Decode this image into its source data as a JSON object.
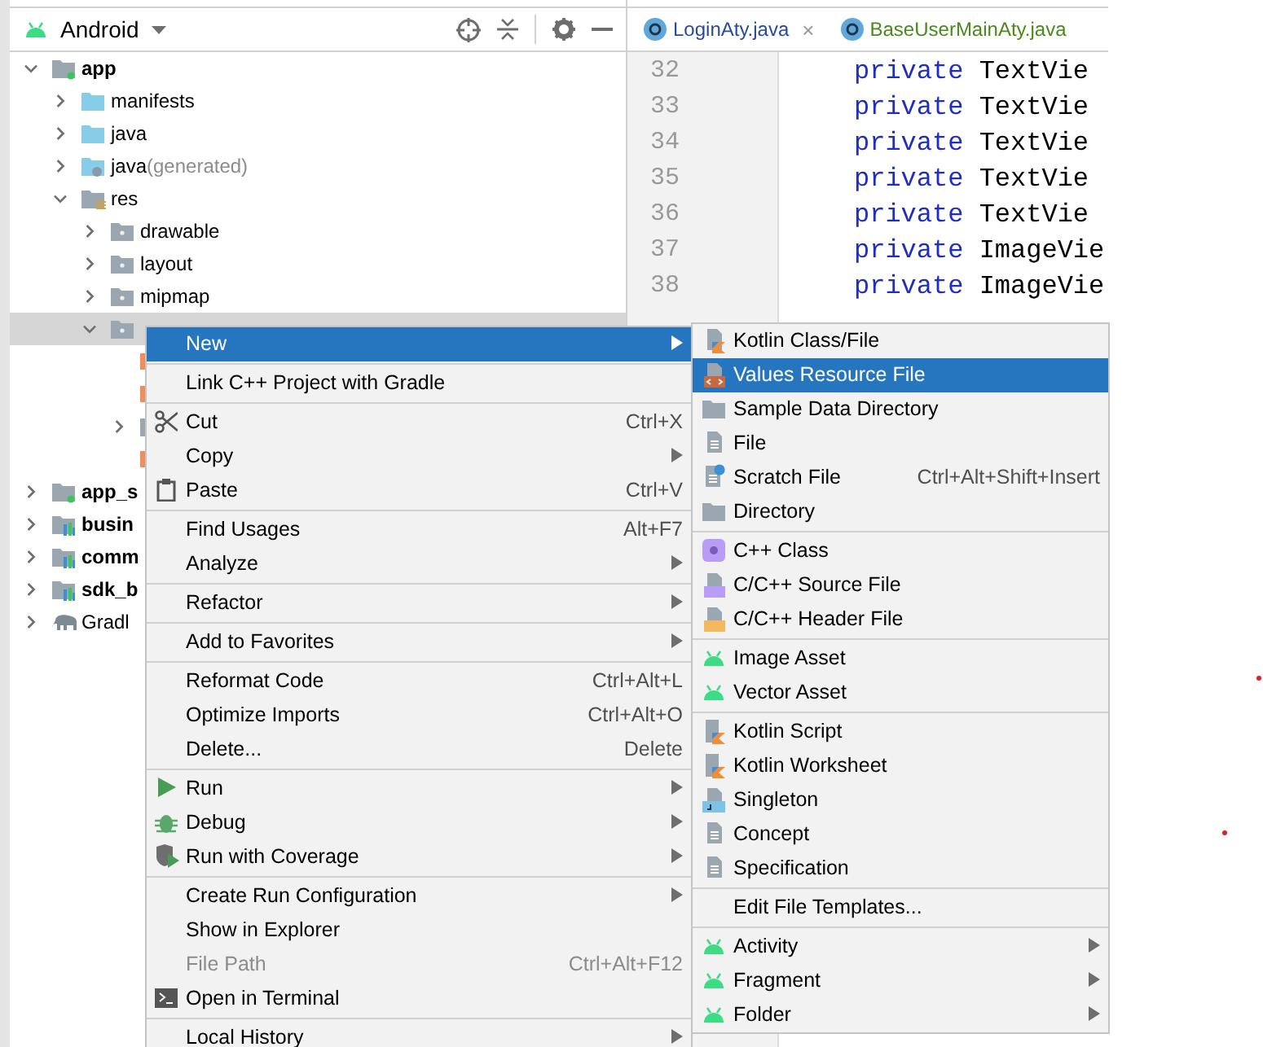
{
  "project_view": {
    "title": "Android",
    "tree": [
      {
        "label": "app",
        "kind": "module",
        "expanded": true,
        "selected": false,
        "children": [
          {
            "label": "manifests",
            "kind": "folder",
            "expanded": false,
            "selected": false
          },
          {
            "label": "java",
            "kind": "folder",
            "expanded": false,
            "selected": false
          },
          {
            "label": "java",
            "suffix": "(generated)",
            "kind": "generated-folder",
            "expanded": false,
            "selected": false
          },
          {
            "label": "res",
            "kind": "res-folder",
            "expanded": true,
            "selected": false,
            "children": [
              {
                "label": "drawable",
                "kind": "package-folder",
                "expanded": false,
                "selected": false
              },
              {
                "label": "layout",
                "kind": "package-folder",
                "expanded": false,
                "selected": false
              },
              {
                "label": "mipmap",
                "kind": "package-folder",
                "expanded": false,
                "selected": false
              },
              {
                "kind": "package-folder",
                "expanded": true,
                "selected": true,
                "children": [
                  {
                    "kind": "xml-file",
                    "selected": false
                  },
                  {
                    "kind": "xml-file",
                    "selected": false
                  },
                  {
                    "kind": "package-folder",
                    "expanded": false,
                    "selected": false
                  },
                  {
                    "kind": "xml-file",
                    "selected": false
                  }
                ]
              }
            ]
          }
        ]
      },
      {
        "label": "app_s",
        "kind": "module",
        "expanded": false,
        "selected": false
      },
      {
        "label": "busin",
        "kind": "library-module",
        "expanded": false,
        "selected": false
      },
      {
        "label": "comm",
        "kind": "library-module",
        "expanded": false,
        "selected": false
      },
      {
        "label": "sdk_b",
        "kind": "library-module",
        "expanded": false,
        "selected": false
      },
      {
        "label": "Gradl",
        "kind": "gradle",
        "expanded": false,
        "selected": false
      }
    ]
  },
  "editor": {
    "tabs": [
      {
        "label": "LoginAty.java",
        "color": "#2a4a9a",
        "close": "×",
        "selected": false
      },
      {
        "label": "BaseUserMainAty.java",
        "color": "#4a8a1a",
        "selected": false
      }
    ],
    "lines": [
      {
        "number": "32",
        "keyword": "private",
        "text": "TextVie"
      },
      {
        "number": "33",
        "keyword": "private",
        "text": "TextVie"
      },
      {
        "number": "34",
        "keyword": "private",
        "text": "TextVie"
      },
      {
        "number": "35",
        "keyword": "private",
        "text": "TextVie"
      },
      {
        "number": "36",
        "keyword": "private",
        "text": "TextVie"
      },
      {
        "number": "37",
        "keyword": "private",
        "text": "ImageVie"
      },
      {
        "number": "38",
        "keyword": "private",
        "text": "ImageVie"
      }
    ]
  },
  "context_menu": {
    "groups": [
      [
        {
          "label": "New",
          "submenu": true,
          "selected": true,
          "disabled": false
        }
      ],
      [
        {
          "label": "Link C++ Project with Gradle",
          "submenu": false,
          "selected": false,
          "disabled": false
        }
      ],
      [
        {
          "label": "Cut",
          "kind": "scissors",
          "shortcut": "Ctrl+X",
          "submenu": false,
          "selected": false,
          "disabled": false
        },
        {
          "label": "Copy",
          "submenu": true,
          "selected": false,
          "disabled": false
        },
        {
          "label": "Paste",
          "kind": "clipboard",
          "shortcut": "Ctrl+V",
          "submenu": false,
          "selected": false,
          "disabled": false
        }
      ],
      [
        {
          "label": "Find Usages",
          "shortcut": "Alt+F7",
          "submenu": false,
          "selected": false,
          "disabled": false
        },
        {
          "label": "Analyze",
          "submenu": true,
          "selected": false,
          "disabled": false
        }
      ],
      [
        {
          "label": "Refactor",
          "submenu": true,
          "selected": false,
          "disabled": false
        }
      ],
      [
        {
          "label": "Add to Favorites",
          "submenu": true,
          "selected": false,
          "disabled": false
        }
      ],
      [
        {
          "label": "Reformat Code",
          "shortcut": "Ctrl+Alt+L",
          "submenu": false,
          "selected": false,
          "disabled": false
        },
        {
          "label": "Optimize Imports",
          "shortcut": "Ctrl+Alt+O",
          "submenu": false,
          "selected": false,
          "disabled": false
        },
        {
          "label": "Delete...",
          "shortcut": "Delete",
          "submenu": false,
          "selected": false,
          "disabled": false
        }
      ],
      [
        {
          "label": "Run",
          "kind": "play",
          "submenu": true,
          "selected": false,
          "disabled": false
        },
        {
          "label": "Debug",
          "kind": "bug",
          "submenu": true,
          "selected": false,
          "disabled": false
        },
        {
          "label": "Run with Coverage",
          "kind": "coverage",
          "submenu": true,
          "selected": false,
          "disabled": false
        }
      ],
      [
        {
          "label": "Create Run Configuration",
          "submenu": true,
          "selected": false,
          "disabled": false
        },
        {
          "label": "Show in Explorer",
          "submenu": false,
          "selected": false,
          "disabled": false
        },
        {
          "label": "File Path",
          "shortcut": "Ctrl+Alt+F12",
          "submenu": false,
          "selected": false,
          "disabled": true
        },
        {
          "label": "Open in Terminal",
          "kind": "terminal",
          "submenu": false,
          "selected": false,
          "disabled": false
        }
      ],
      [
        {
          "label": "Local History",
          "submenu": true,
          "selected": false,
          "disabled": false
        }
      ]
    ]
  },
  "submenu": {
    "groups": [
      [
        {
          "label": "Kotlin Class/File",
          "kind": "kotlin-file",
          "submenu": false,
          "selected": false,
          "disabled": false
        },
        {
          "label": "Values Resource File",
          "kind": "values-file",
          "submenu": false,
          "selected": true,
          "disabled": false
        },
        {
          "label": "Sample Data Directory",
          "kind": "folder",
          "submenu": false,
          "selected": false,
          "disabled": false
        },
        {
          "label": "File",
          "kind": "document",
          "submenu": false,
          "selected": false,
          "disabled": false
        },
        {
          "label": "Scratch File",
          "kind": "scratch",
          "shortcut": "Ctrl+Alt+Shift+Insert",
          "submenu": false,
          "selected": false,
          "disabled": false
        },
        {
          "label": "Directory",
          "kind": "folder",
          "submenu": false,
          "selected": false,
          "disabled": false
        }
      ],
      [
        {
          "label": "C++ Class",
          "kind": "cpp-class",
          "submenu": false,
          "selected": false,
          "disabled": false
        },
        {
          "label": "C/C++ Source File",
          "kind": "cpp-source",
          "submenu": false,
          "selected": false,
          "disabled": false
        },
        {
          "label": "C/C++ Header File",
          "kind": "cpp-header",
          "submenu": false,
          "selected": false,
          "disabled": false
        }
      ],
      [
        {
          "label": "Image Asset",
          "kind": "robot",
          "submenu": false,
          "selected": false,
          "disabled": false
        },
        {
          "label": "Vector Asset",
          "kind": "robot",
          "submenu": false,
          "selected": false,
          "disabled": false
        }
      ],
      [
        {
          "label": "Kotlin Script",
          "kind": "kotlin-script",
          "submenu": false,
          "selected": false,
          "disabled": false
        },
        {
          "label": "Kotlin Worksheet",
          "kind": "kotlin-script",
          "submenu": false,
          "selected": false,
          "disabled": false
        },
        {
          "label": "Singleton",
          "kind": "singleton",
          "submenu": false,
          "selected": false,
          "disabled": false
        },
        {
          "label": "Concept",
          "kind": "document",
          "submenu": false,
          "selected": false,
          "disabled": false
        },
        {
          "label": "Specification",
          "kind": "document",
          "submenu": false,
          "selected": false,
          "disabled": false
        }
      ],
      [
        {
          "label": "Edit File Templates...",
          "submenu": false,
          "selected": false,
          "disabled": false
        }
      ],
      [
        {
          "label": "Activity",
          "kind": "robot",
          "submenu": true,
          "selected": false,
          "disabled": false
        },
        {
          "label": "Fragment",
          "kind": "robot",
          "submenu": true,
          "selected": false,
          "disabled": false
        },
        {
          "label": "Folder",
          "kind": "robot",
          "submenu": true,
          "selected": false,
          "disabled": false
        }
      ]
    ]
  }
}
